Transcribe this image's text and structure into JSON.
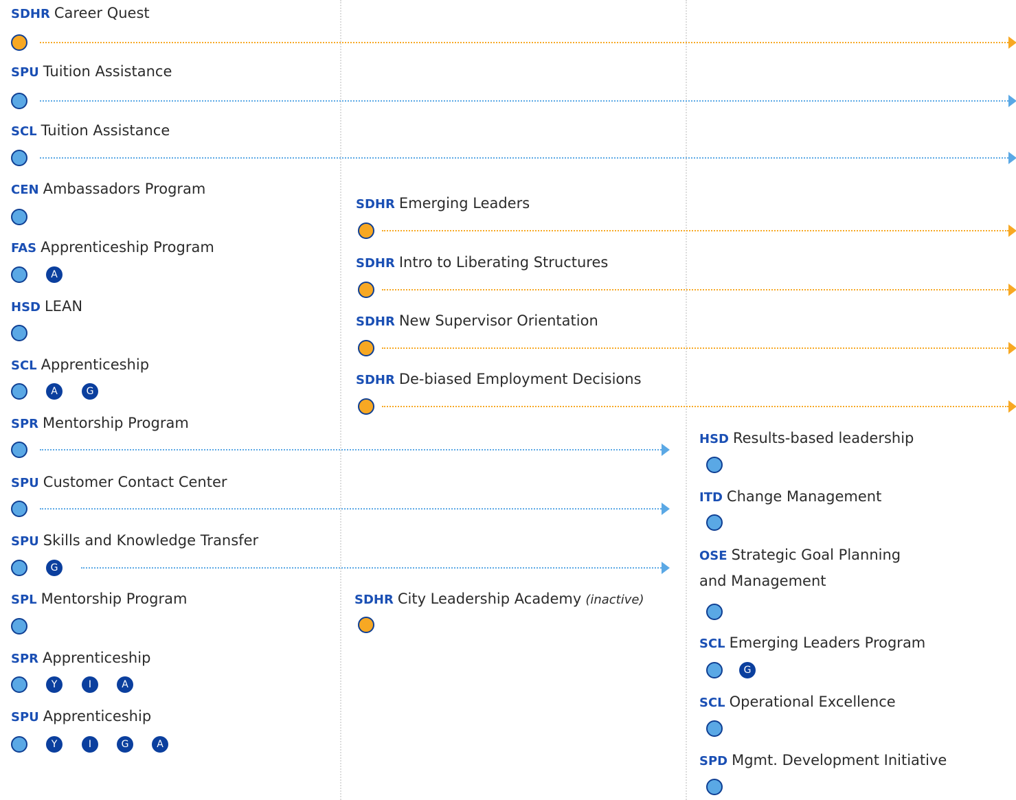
{
  "programs": [
    {
      "dept": "SDHR",
      "name": "Career Quest",
      "color": "orange",
      "badges": [],
      "arrow": "right"
    },
    {
      "dept": "SPU",
      "name": "Tuition Assistance",
      "color": "blue",
      "badges": [],
      "arrow": "right"
    },
    {
      "dept": "SCL",
      "name": "Tuition Assistance",
      "color": "blue",
      "badges": [],
      "arrow": "right"
    },
    {
      "dept": "CEN",
      "name": "Ambassadors Program",
      "color": "blue",
      "badges": [],
      "arrow": "none"
    },
    {
      "dept": "FAS",
      "name": "Apprenticeship Program",
      "color": "blue",
      "badges": [
        "A"
      ],
      "arrow": "none"
    },
    {
      "dept": "HSD",
      "name": "LEAN",
      "color": "blue",
      "badges": [],
      "arrow": "none"
    },
    {
      "dept": "SCL",
      "name": "Apprenticeship",
      "color": "blue",
      "badges": [
        "A",
        "G"
      ],
      "arrow": "none"
    },
    {
      "dept": "SPR",
      "name": "Mentorship Program",
      "color": "blue",
      "badges": [],
      "arrow": "mid"
    },
    {
      "dept": "SPU",
      "name": "Customer Contact Center",
      "color": "blue",
      "badges": [],
      "arrow": "mid"
    },
    {
      "dept": "SPU",
      "name": "Skills and Knowledge Transfer",
      "color": "blue",
      "badges": [
        "G"
      ],
      "arrow": "mid"
    },
    {
      "dept": "SPL",
      "name": "Mentorship Program",
      "color": "blue",
      "badges": [],
      "arrow": "none"
    },
    {
      "dept": "SPR",
      "name": "Apprenticeship",
      "color": "blue",
      "badges": [
        "Y",
        "I",
        "A"
      ],
      "arrow": "none"
    },
    {
      "dept": "SPU",
      "name": "Apprenticeship",
      "color": "blue",
      "badges": [
        "Y",
        "I",
        "G",
        "A"
      ],
      "arrow": "none"
    },
    {
      "dept": "SDHR",
      "name": "Emerging Leaders",
      "color": "orange",
      "badges": [],
      "arrow": "right"
    },
    {
      "dept": "SDHR",
      "name": "Intro to Liberating Structures",
      "color": "orange",
      "badges": [],
      "arrow": "right"
    },
    {
      "dept": "SDHR",
      "name": "New Supervisor Orientation",
      "color": "orange",
      "badges": [],
      "arrow": "right"
    },
    {
      "dept": "SDHR",
      "name": "De-biased Employment Decisions",
      "color": "orange",
      "badges": [],
      "arrow": "right"
    },
    {
      "dept": "SDHR",
      "name": "City Leadership Academy",
      "note": "(inactive)",
      "color": "orange",
      "badges": [],
      "arrow": "none"
    },
    {
      "dept": "HSD",
      "name": "Results-based leadership",
      "color": "blue",
      "badges": [],
      "arrow": "none"
    },
    {
      "dept": "ITD",
      "name": "Change Management",
      "color": "blue",
      "badges": [],
      "arrow": "none"
    },
    {
      "dept": "OSE",
      "name": "Strategic Goal Planning",
      "name_line2": "and Management",
      "color": "blue",
      "badges": [],
      "arrow": "none"
    },
    {
      "dept": "SCL",
      "name": "Emerging Leaders Program",
      "color": "blue",
      "badges": [
        "G"
      ],
      "arrow": "none"
    },
    {
      "dept": "SCL",
      "name": "Operational Excellence",
      "color": "blue",
      "badges": [],
      "arrow": "none"
    },
    {
      "dept": "SPD",
      "name": "Mgmt. Development Initiative",
      "color": "blue",
      "badges": [],
      "arrow": "none"
    }
  ],
  "colors": {
    "blue": "#5aa8e5",
    "orange": "#f7a823",
    "dept_text": "#1a4fb4",
    "badge": "#0b3f9e"
  }
}
